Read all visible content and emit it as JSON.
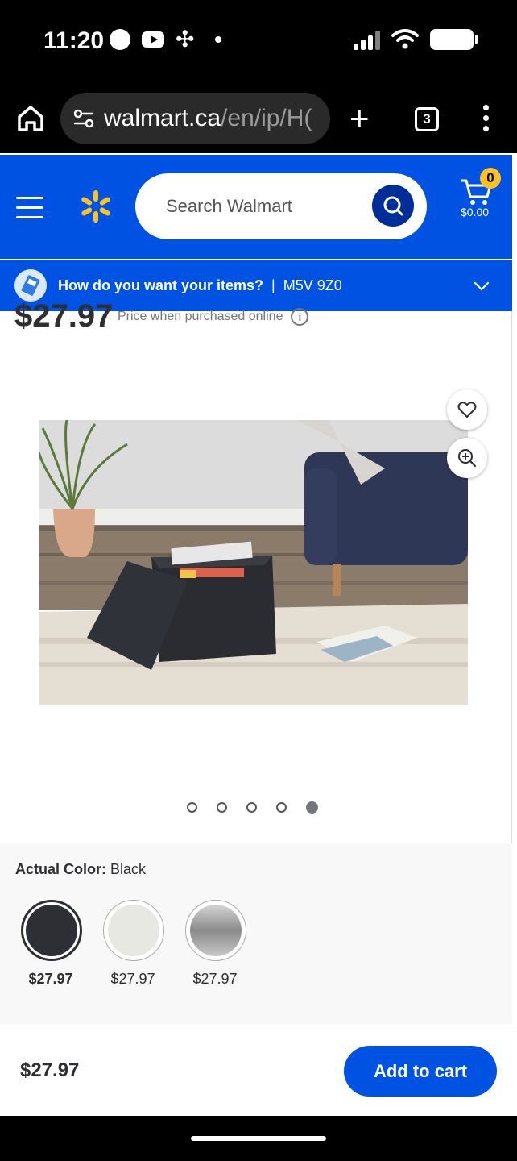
{
  "status_bar": {
    "time": "11:20"
  },
  "browser": {
    "url_host": "walmart.ca",
    "url_path": "/en/ip/H(",
    "tab_count": "3"
  },
  "header": {
    "search_placeholder": "Search Walmart",
    "cart_count": "0",
    "cart_total": "$0.00"
  },
  "delivery": {
    "prompt": "How do you want your items?",
    "separator": "|",
    "postal_code": "M5V 9Z0"
  },
  "product": {
    "price": "$27.97",
    "price_note": "Price when purchased online",
    "carousel": {
      "total": 5,
      "active_index": 4
    }
  },
  "variants": {
    "label": "Actual Color:",
    "selected_value": "Black",
    "options": [
      {
        "color": "#2e2f35",
        "price": "$27.97",
        "selected": true
      },
      {
        "color": "#e8e8e2",
        "price": "$27.97",
        "selected": false
      },
      {
        "color": "#8a8a8a",
        "price": "$27.97",
        "selected": false
      }
    ]
  },
  "bottom_bar": {
    "price": "$27.97",
    "add_to_cart_label": "Add to cart"
  },
  "colors": {
    "walmart_blue": "#0053e2",
    "walmart_yellow": "#ffc220",
    "search_button": "#002e99"
  }
}
